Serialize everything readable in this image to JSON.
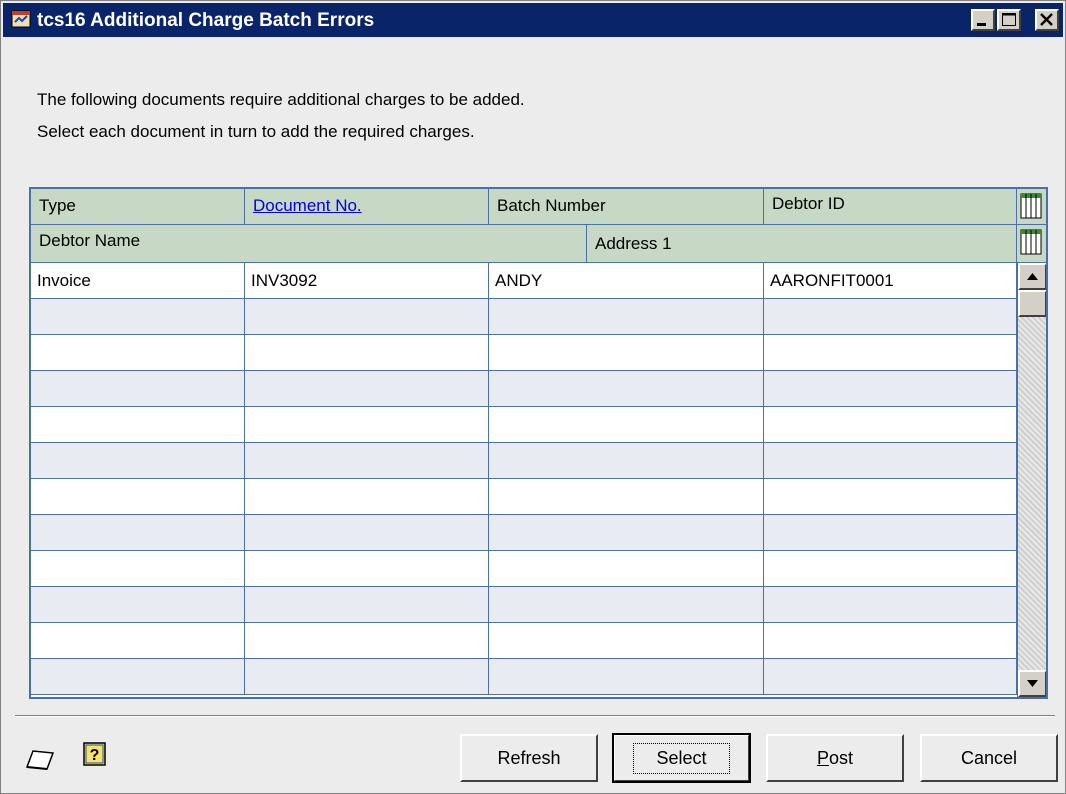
{
  "window": {
    "title": "tcs16 Additional Charge Batch Errors"
  },
  "message": {
    "line1": "The following documents require additional charges to be added.",
    "line2": "Select each document in turn to add the required charges."
  },
  "grid": {
    "headers_row1": [
      "Type",
      "Document No.",
      "Batch Number",
      "Debtor ID"
    ],
    "headers_row2": [
      "Debtor Name",
      "Address 1"
    ],
    "rows": [
      [
        "Invoice",
        "INV3092",
        "ANDY",
        "AARONFIT0001"
      ]
    ]
  },
  "buttons": {
    "refresh": "Refresh",
    "select": "Select",
    "post_first": "P",
    "post_rest": "ost",
    "cancel": "Cancel"
  },
  "colors": {
    "title_bar": "#0a246a",
    "grid_header": "#c7d8c5",
    "grid_line": "#4a70a6"
  }
}
